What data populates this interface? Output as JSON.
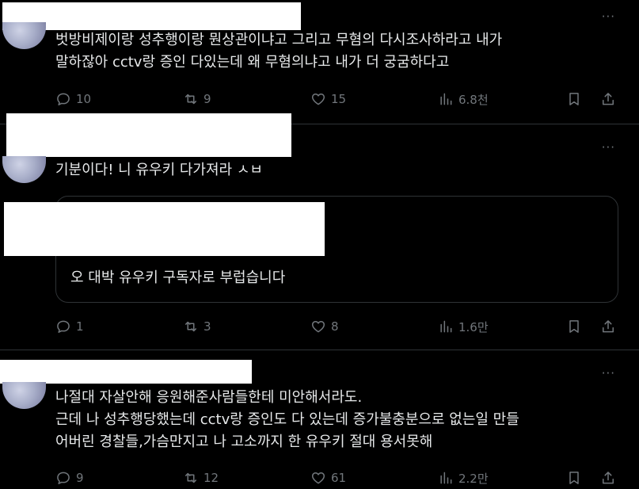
{
  "posts": [
    {
      "text_lines": [
        "벗방비제이랑 성추행이랑 뭔상관이냐고 그리고 무혐의 다시조사하라고 내가",
        "말하잖아 cctv랑 증인 다있는데 왜 무혐의냐고 내가 더 궁굼하다고"
      ],
      "replies": "10",
      "reposts": "9",
      "likes": "15",
      "views": "6.8천",
      "more": "···"
    },
    {
      "text_lines": [
        "기분이다! 니 유우키 다가져라 ㅅㅂ"
      ],
      "quote_text": "오 대박 유우키 구독자로 부럽습니다",
      "replies": "1",
      "reposts": "3",
      "likes": "8",
      "views": "1.6만",
      "more": "···"
    },
    {
      "text_lines": [
        "나절대 자살안해 응원해준사람들한테 미안해서라도.",
        "근데 나 성추행당했는데 cctv랑 증인도 다 있는데 증가불충분으로 없는일 만들",
        "어버린 경찰들,가슴만지고 나 고소까지 한 유우키 절대 용서못해"
      ],
      "replies": "9",
      "reposts": "12",
      "likes": "61",
      "views": "2.2만",
      "more": "···"
    }
  ],
  "icons": {
    "reply": "reply-icon",
    "repost": "repost-icon",
    "like": "heart-icon",
    "views": "views-icon",
    "bookmark": "bookmark-icon",
    "share": "share-icon",
    "more": "more-icon"
  }
}
